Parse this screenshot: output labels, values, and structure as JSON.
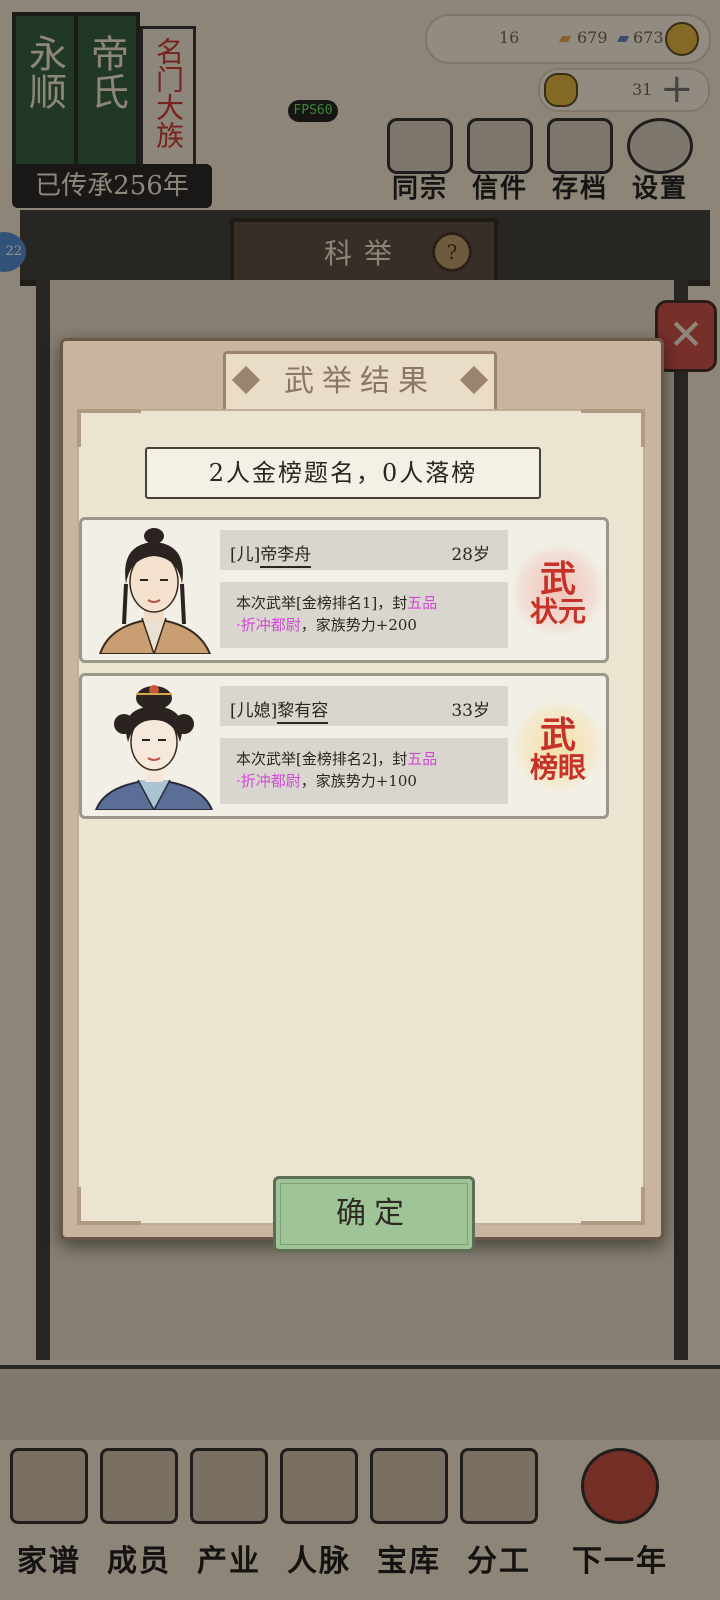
{
  "background": {
    "family_banner": {
      "family": "永顺",
      "surname": "帝氏",
      "side_label": "名门大族",
      "generations": "已传承256年"
    },
    "resources": [
      "16",
      "679",
      "673"
    ],
    "resource2": "31",
    "fps": "FPS60",
    "top_nav": [
      {
        "label": "同宗",
        "icon": "clan-books-icon"
      },
      {
        "label": "信件",
        "icon": "letter-icon"
      },
      {
        "label": "存档",
        "icon": "scroll-save-icon"
      },
      {
        "label": "设置",
        "icon": "settings-vase-icon"
      }
    ],
    "level_badge": "22",
    "hall_title": "科举",
    "help": "?",
    "bottom_nav": [
      {
        "label": "家谱",
        "icon": "genealogy-book-icon"
      },
      {
        "label": "成员",
        "icon": "member-figure-icon"
      },
      {
        "label": "产业",
        "icon": "building-icon"
      },
      {
        "label": "人脉",
        "icon": "network-icon"
      },
      {
        "label": "宝库",
        "icon": "treasure-box-icon"
      },
      {
        "label": "分工",
        "icon": "scroll-task-icon"
      },
      {
        "label": "下一年",
        "icon": "lantern-icon"
      }
    ]
  },
  "dialog": {
    "title": "武举结果",
    "summary": "2人金榜题名，0人落榜",
    "results": [
      {
        "tag": "[儿]",
        "name": "帝李舟",
        "age": "28岁",
        "desc_prefix": "本次武举[金榜排名1]，封",
        "desc_rank_a": "五品",
        "desc_rank_b": "·折冲都尉",
        "desc_suffix": "，家族势力+200",
        "stamp_line1": "武",
        "stamp_line2": "状元",
        "stamp_color": "#c63128"
      },
      {
        "tag": "[儿媳]",
        "name": "黎有容",
        "age": "33岁",
        "desc_prefix": "本次武举[金榜排名2]，封",
        "desc_rank_a": "五品",
        "desc_rank_b": "·折冲都尉",
        "desc_suffix": "，家族势力+100",
        "stamp_line1": "武",
        "stamp_line2": "榜眼",
        "stamp_color": "#c63128"
      }
    ],
    "confirm": "确定"
  }
}
